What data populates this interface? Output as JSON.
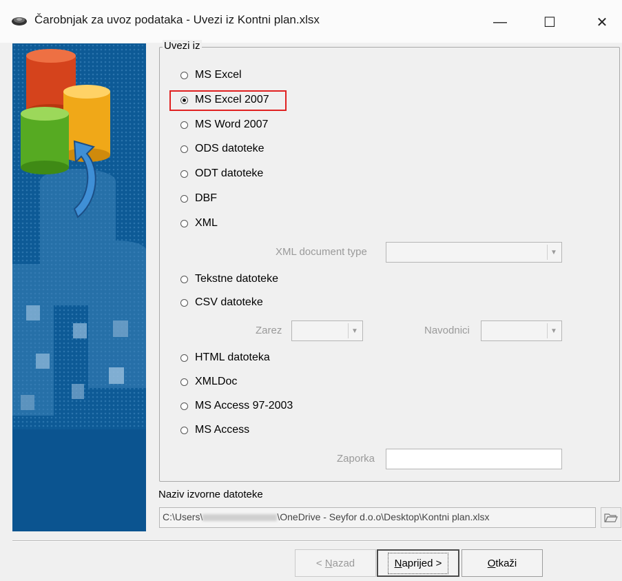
{
  "window": {
    "title": "Čarobnjak za uvoz podataka - Uvezi iz Kontni plan.xlsx",
    "minimize_glyph": "—",
    "maximize_glyph": "☐",
    "close_glyph": "✕"
  },
  "group": {
    "legend": "Uvezi iz",
    "options": [
      {
        "label": "MS Excel",
        "selected": false
      },
      {
        "label": "MS Excel 2007",
        "selected": true
      },
      {
        "label": "MS Word 2007",
        "selected": false
      },
      {
        "label": "ODS datoteke",
        "selected": false
      },
      {
        "label": "ODT datoteke",
        "selected": false
      },
      {
        "label": "DBF",
        "selected": false
      },
      {
        "label": "XML",
        "selected": false
      },
      {
        "label": "Tekstne datoteke",
        "selected": false
      },
      {
        "label": "CSV datoteke",
        "selected": false
      },
      {
        "label": "HTML datoteka",
        "selected": false
      },
      {
        "label": "XMLDoc",
        "selected": false
      },
      {
        "label": "MS Access 97-2003",
        "selected": false
      },
      {
        "label": "MS Access",
        "selected": false
      }
    ],
    "xml_document_type_label": "XML document type",
    "zarez_label": "Zarez",
    "navodnici_label": "Navodnici",
    "zaporka_label": "Zaporka"
  },
  "source": {
    "label": "Naziv izvorne datoteke",
    "path_prefix": "C:\\Users\\",
    "path_suffix": "\\OneDrive - Seyfor d.o.o\\Desktop\\Kontni plan.xlsx"
  },
  "buttons": {
    "back_prefix": "< ",
    "back_mnemonic": "N",
    "back_rest": "azad",
    "next_mnemonic": "N",
    "next_rest": "aprijed >",
    "cancel_mnemonic": "O",
    "cancel_rest": "tkaži"
  },
  "colors": {
    "accent_highlight": "#e02020",
    "side_panel": "#0d5a96"
  }
}
